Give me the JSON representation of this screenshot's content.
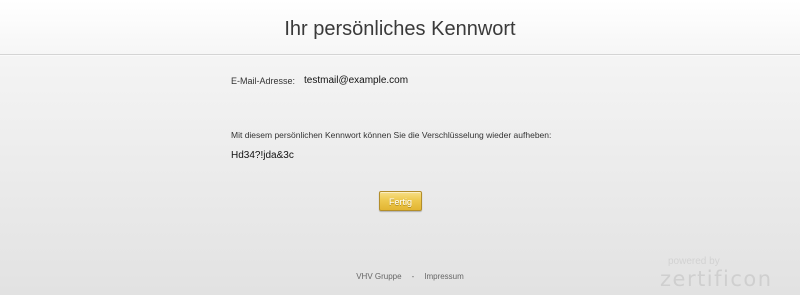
{
  "header": {
    "title": "Ihr persönliches Kennwort"
  },
  "form": {
    "email_label": "E-Mail-Adresse:",
    "email_value": "testmail@example.com",
    "info_text": "Mit diesem persönlichen Kennwort können Sie die Verschlüsselung wieder aufheben:",
    "password_value": "Hd34?!jda&3c",
    "done_button_label": "Fertig"
  },
  "footer": {
    "link_1": "VHV Gruppe",
    "separator": "-",
    "link_2": "Impressum"
  },
  "brand": {
    "powered_by": "powered by",
    "name": "zertificon"
  },
  "colors": {
    "button_accent": "#eec94f",
    "brand_watermark": "#cfcfcf"
  }
}
